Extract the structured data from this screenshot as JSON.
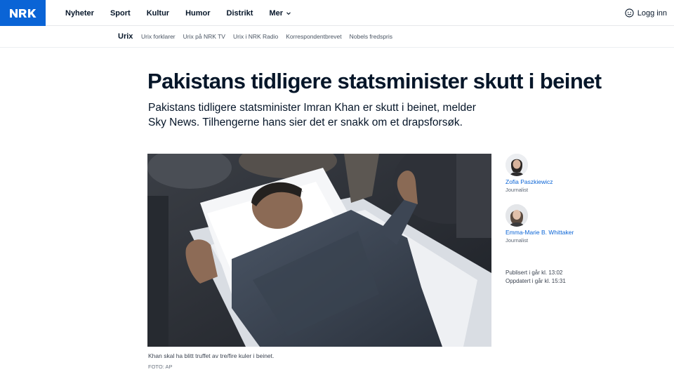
{
  "brand": {
    "logo_text": "NRK",
    "color": "#0a64d6"
  },
  "nav": {
    "items": [
      "Nyheter",
      "Sport",
      "Kultur",
      "Humor",
      "Distrikt",
      "Mer"
    ],
    "login_label": "Logg inn"
  },
  "subnav": {
    "section": "Urix",
    "links": [
      "Urix forklarer",
      "Urix på NRK TV",
      "Urix i NRK Radio",
      "Korrespondentbrevet",
      "Nobels fredspris"
    ]
  },
  "article": {
    "headline": "Pakistans tidligere statsminister skutt i beinet",
    "lead": "Pakistans tidligere statsminister Imran Khan er skutt i beinet, melder Sky News. Tilhengerne hans sier det er snakk om et drapsforsøk.",
    "image_caption": "Khan skal ha blitt truffet av tre/fire kuler i beinet.",
    "image_credit": "FOTO: AP"
  },
  "authors": [
    {
      "name": "Zofia Paszkiewicz",
      "role": "Journalist"
    },
    {
      "name": "Emma-Marie B. Whittaker",
      "role": "Journalist"
    }
  ],
  "dates": {
    "published": "Publisert i går kl. 13:02",
    "updated": "Oppdatert i går kl. 15:31"
  },
  "icons": {
    "menu_chevron": "chevron-down-icon",
    "login": "user-circle-icon"
  }
}
